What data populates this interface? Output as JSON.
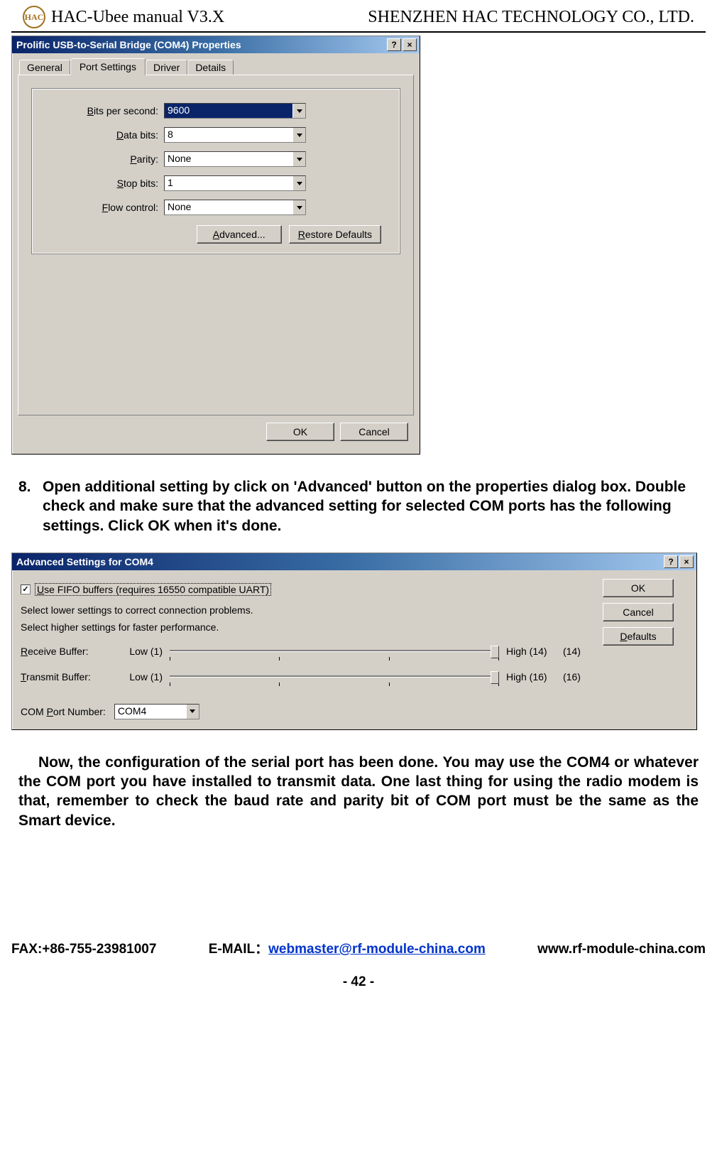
{
  "header": {
    "doc_title": "HAC-Ubee manual V3.X",
    "company": "SHENZHEN HAC TECHNOLOGY CO., LTD."
  },
  "properties_dialog": {
    "title": "Prolific USB-to-Serial Bridge (COM4) Properties",
    "help_btn": "?",
    "close_btn": "×",
    "tabs": {
      "general": "General",
      "port_settings": "Port Settings",
      "driver": "Driver",
      "details": "Details"
    },
    "fields": {
      "bits_per_second": {
        "label": "Bits per second:",
        "mn": "B",
        "value": "9600"
      },
      "data_bits": {
        "label": "Data bits:",
        "mn": "D",
        "value": "8"
      },
      "parity": {
        "label": "Parity:",
        "mn": "P",
        "value": "None"
      },
      "stop_bits": {
        "label": "Stop bits:",
        "mn": "S",
        "value": "1"
      },
      "flow_control": {
        "label": "Flow control:",
        "mn": "F",
        "value": "None"
      }
    },
    "buttons": {
      "advanced": "Advanced...",
      "advanced_mn": "A",
      "restore": "Restore Defaults",
      "restore_mn": "R",
      "ok": "OK",
      "cancel": "Cancel"
    }
  },
  "step8": {
    "num": "8.",
    "text": "Open additional setting by click on 'Advanced' button on the properties dialog box. Double check and make sure that the advanced setting for selected COM ports has the following settings. Click OK when it's done."
  },
  "advanced_dialog": {
    "title": "Advanced Settings for COM4",
    "help_btn": "?",
    "close_btn": "×",
    "use_fifo": {
      "checked": true,
      "label": "Use FIFO buffers (requires 16550 compatible UART)",
      "mn": "U"
    },
    "help1": "Select lower settings to correct connection problems.",
    "help2": "Select higher settings for faster performance.",
    "receive": {
      "label": "Receive Buffer:",
      "mn": "R",
      "low": "Low (1)",
      "high": "High (14)",
      "value": "(14)"
    },
    "transmit": {
      "label": "Transmit Buffer:",
      "mn": "T",
      "low": "Low (1)",
      "high": "High (16)",
      "value": "(16)"
    },
    "com_port": {
      "label": "COM Port Number:",
      "mn": "P",
      "value": "COM4"
    },
    "buttons": {
      "ok": "OK",
      "cancel": "Cancel",
      "defaults": "Defaults",
      "defaults_mn": "D"
    }
  },
  "conclusion": "Now, the configuration of the serial port has been done. You may use the COM4 or whatever the COM port you have installed to transmit data. One last thing for using the radio modem is that, remember to check the baud rate and parity bit of COM port must be the same as the Smart device.",
  "footer": {
    "fax": "FAX:+86-755-23981007",
    "email_label": "E-MAIL：",
    "email": "webmaster@rf-module-china.com",
    "www": "www.rf-module-china.com",
    "page": "- 42 -"
  }
}
